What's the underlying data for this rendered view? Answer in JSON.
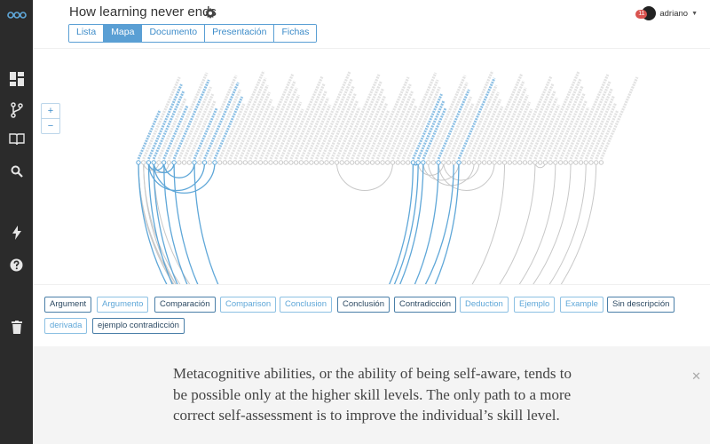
{
  "header": {
    "title": "How learning never ends"
  },
  "tabs": [
    {
      "label": "Lista",
      "active": false
    },
    {
      "label": "Mapa",
      "active": true
    },
    {
      "label": "Documento",
      "active": false
    },
    {
      "label": "Presentación",
      "active": false
    },
    {
      "label": "Fichas",
      "active": false
    }
  ],
  "user": {
    "name": "adriano",
    "notifications": "11"
  },
  "zoom": {
    "plus": "+",
    "minus": "−"
  },
  "sidebar": {
    "icons": [
      "logo-icon",
      "dashboard-icon",
      "branch-icon",
      "book-icon",
      "search-icon",
      "bolt-icon",
      "help-icon",
      "trash-icon"
    ]
  },
  "tags": [
    {
      "label": "Argument",
      "style": "dark"
    },
    {
      "label": "Argumento",
      "style": "light"
    },
    {
      "label": "Comparación",
      "style": "dark"
    },
    {
      "label": "Comparison",
      "style": "light"
    },
    {
      "label": "Conclusion",
      "style": "light"
    },
    {
      "label": "Conclusión",
      "style": "dark"
    },
    {
      "label": "Contradicción",
      "style": "dark"
    },
    {
      "label": "Deduction",
      "style": "light"
    },
    {
      "label": "Ejemplo",
      "style": "light"
    },
    {
      "label": "Example",
      "style": "light"
    },
    {
      "label": "Sin descripción",
      "style": "dark"
    },
    {
      "label": "derivada",
      "style": "light"
    },
    {
      "label": "ejemplo contradicción",
      "style": "dark"
    }
  ],
  "description": {
    "text": "Metacognitive abilities, or the ability of being self-aware, tends to be possible only at the higher skill levels. The only path to a more correct self-assessment is to improve the individual’s skill level."
  },
  "colors": {
    "sidebar": "#2b2b2b",
    "accent": "#5a9fd4",
    "link_highlight": "#5fa7d8",
    "link_gray": "#c8c8c8"
  }
}
